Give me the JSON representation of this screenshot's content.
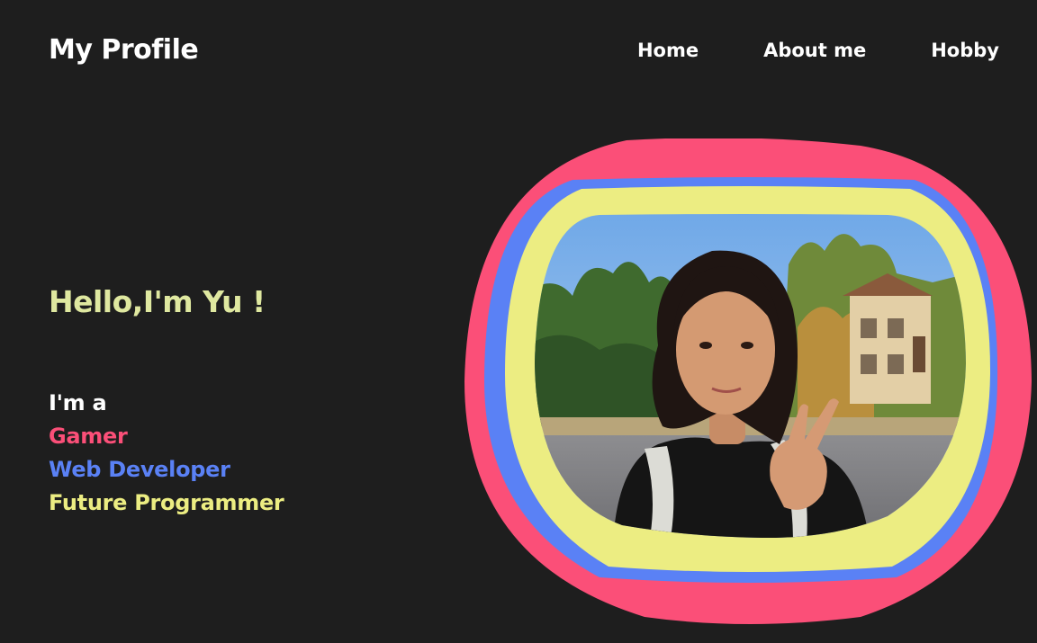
{
  "header": {
    "title": "My Profile",
    "nav": [
      {
        "label": "Home"
      },
      {
        "label": "About me"
      },
      {
        "label": "Hobby"
      }
    ]
  },
  "hero": {
    "greeting": "Hello,I'm Yu !",
    "intro": "I'm a",
    "roles": [
      {
        "label": "Gamer"
      },
      {
        "label": "Web Developer"
      },
      {
        "label": "Future Programmer"
      }
    ]
  },
  "colors": {
    "background": "#1e1e1e",
    "text": "#ffffff",
    "greeting": "#dfe8a0",
    "pink": "#fb4f78",
    "blue": "#5a81f5",
    "yellow": "#eced82"
  },
  "profile_photo": {
    "icon": "selfie-photo-peace-sign"
  }
}
